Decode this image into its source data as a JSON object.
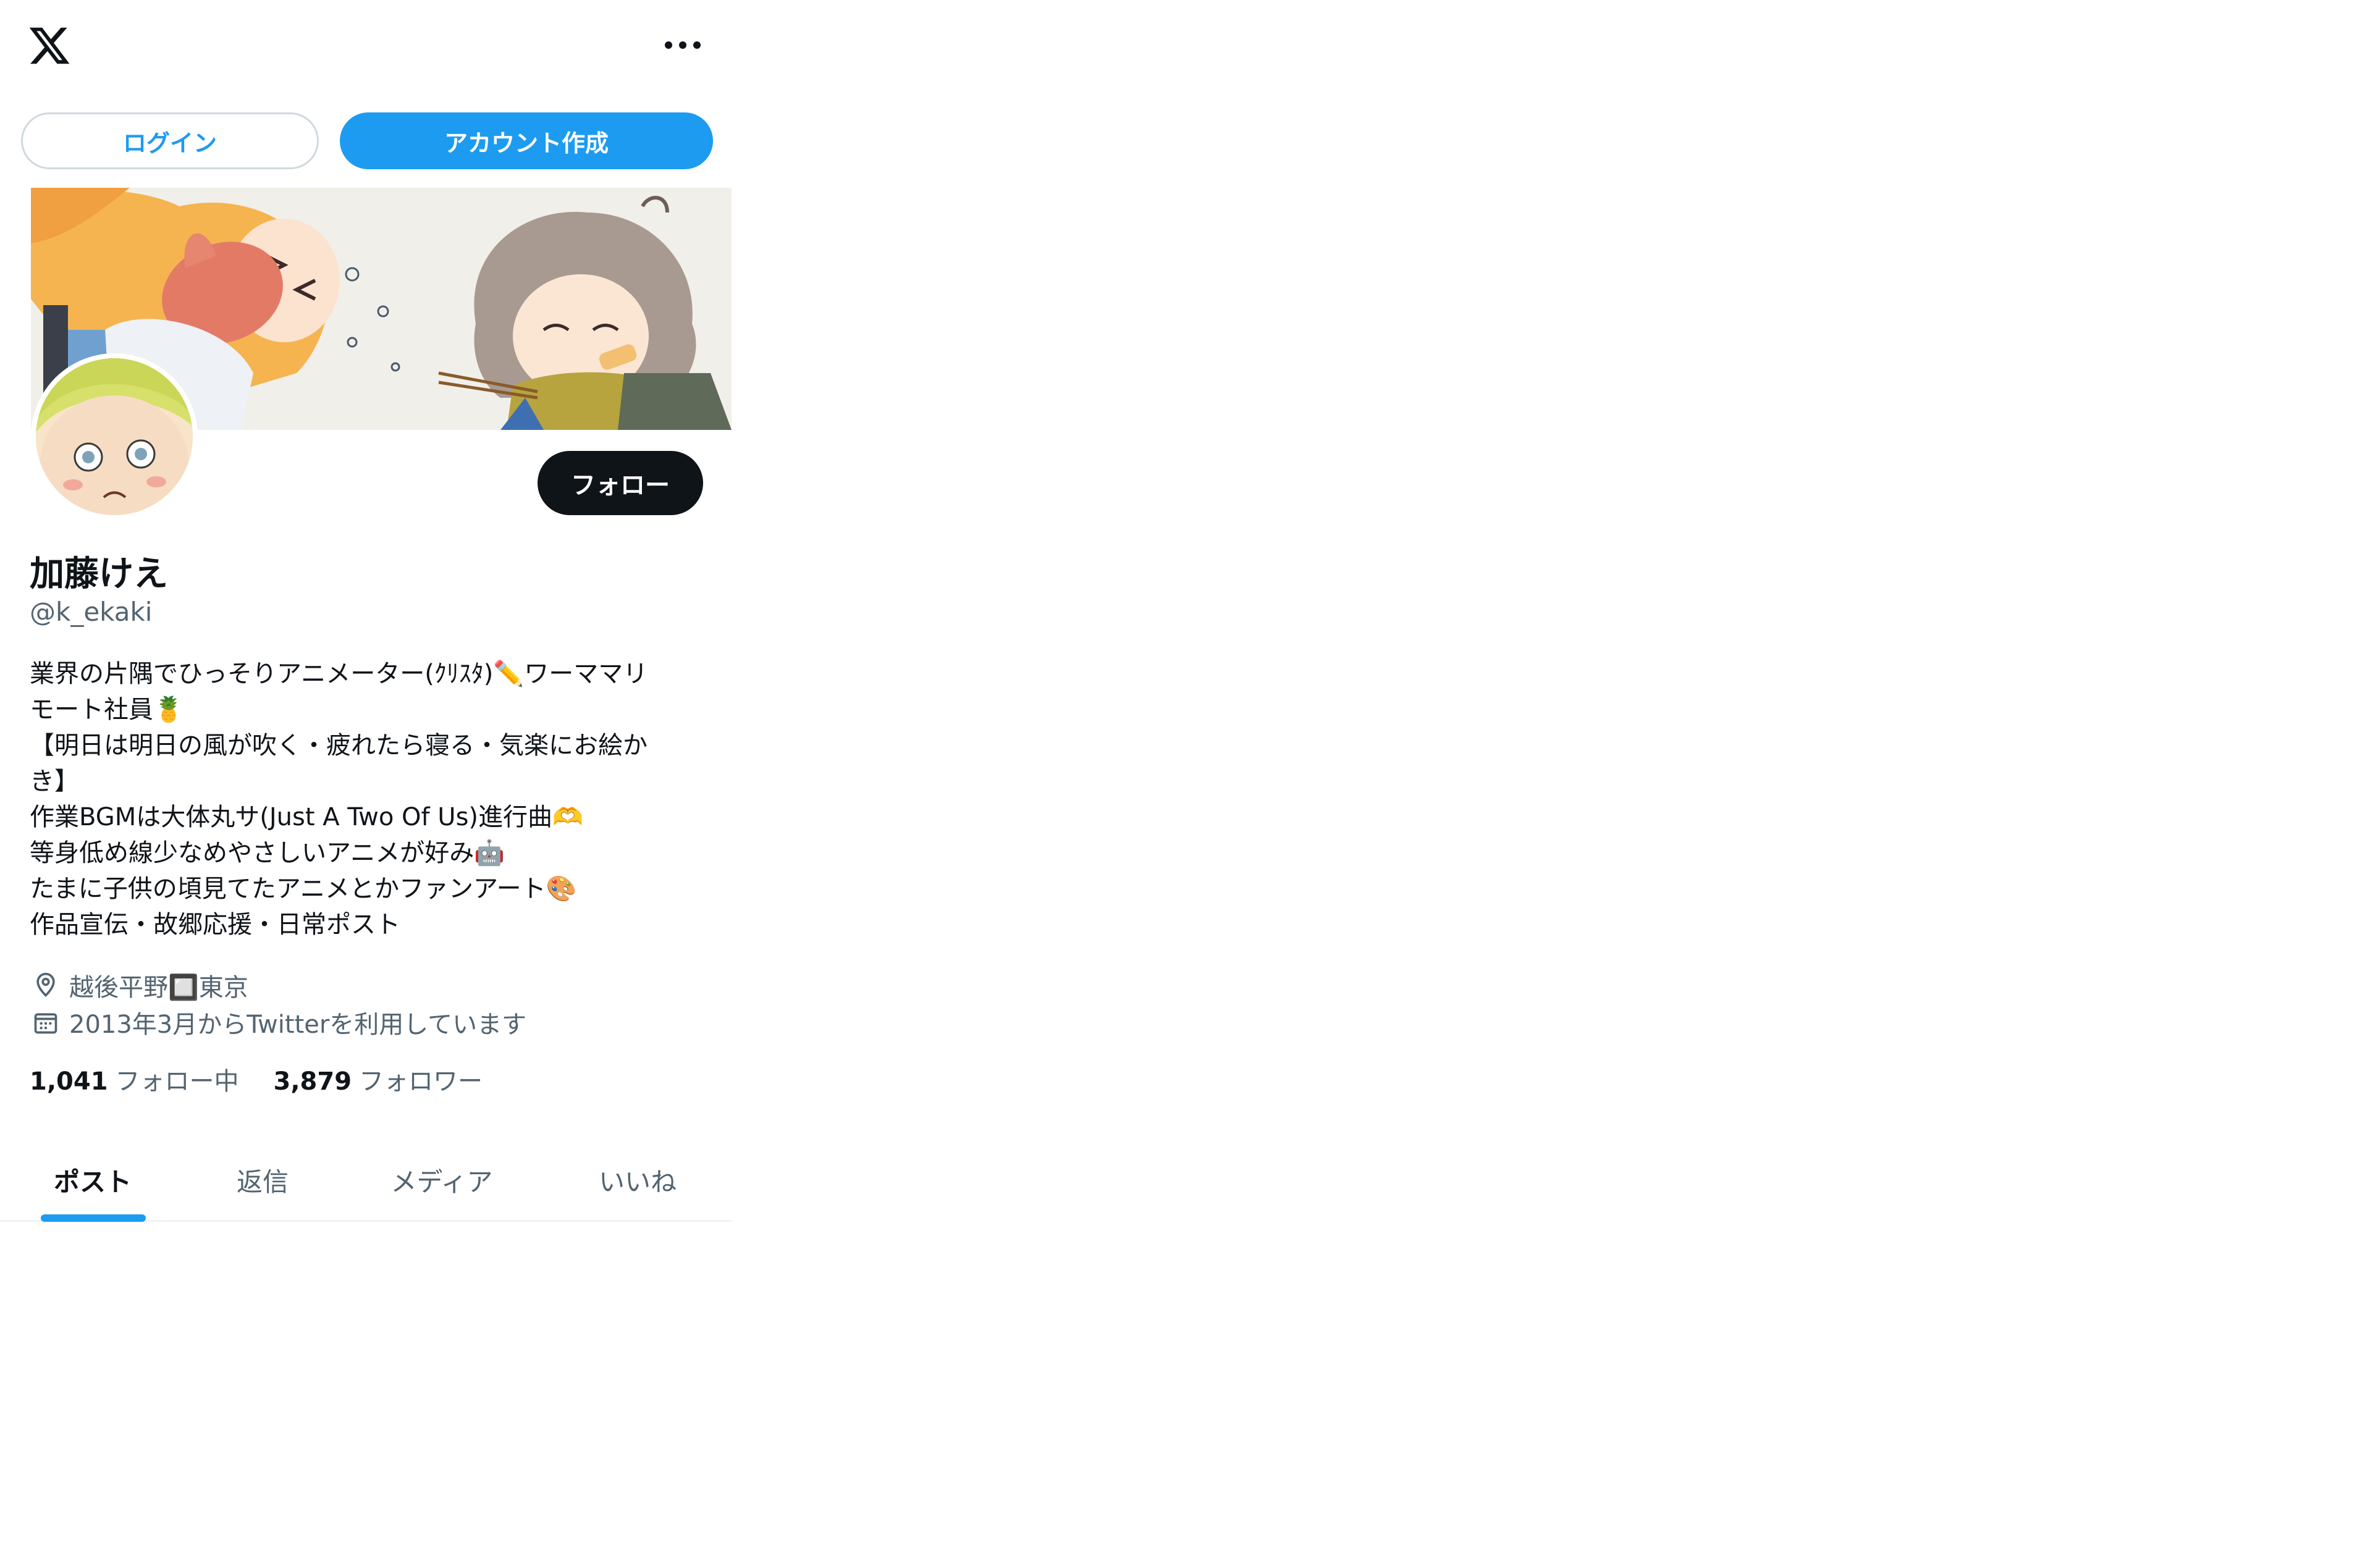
{
  "header": {
    "logo": "x-logo-icon",
    "more": "more-icon"
  },
  "auth": {
    "login_label": "ログイン",
    "signup_label": "アカウント作成"
  },
  "profile": {
    "follow_label": "フォロー",
    "display_name": "加藤けえ",
    "handle": "@k_ekaki",
    "bio_lines": [
      "業界の片隅でひっそりアニメーター(ｸﾘｽﾀ)✏️ワーママリ",
      "モート社員🍍",
      "【明日は明日の風が吹く・疲れたら寝る・気楽にお絵か",
      "き】",
      "作業BGMは大体丸サ(Just A Two Of Us)進行曲🫶",
      "等身低め線少なめやさしいアニメが好み🤖",
      "たまに子供の頃見てたアニメとかファンアート🎨",
      "作品宣伝・故郷応援・日常ポスト"
    ],
    "location": "越後平野🔲東京",
    "joined": "2013年3月からTwitterを利用しています",
    "following_count": "1,041",
    "following_label": "フォロー中",
    "followers_count": "3,879",
    "followers_label": "フォロワー"
  },
  "tabs": [
    {
      "label": "ポスト",
      "active": true
    },
    {
      "label": "返信",
      "active": false
    },
    {
      "label": "メディア",
      "active": false
    },
    {
      "label": "いいね",
      "active": false
    }
  ],
  "colors": {
    "accent": "#1d9bf0",
    "text": "#0f1419",
    "secondary": "#536471"
  }
}
